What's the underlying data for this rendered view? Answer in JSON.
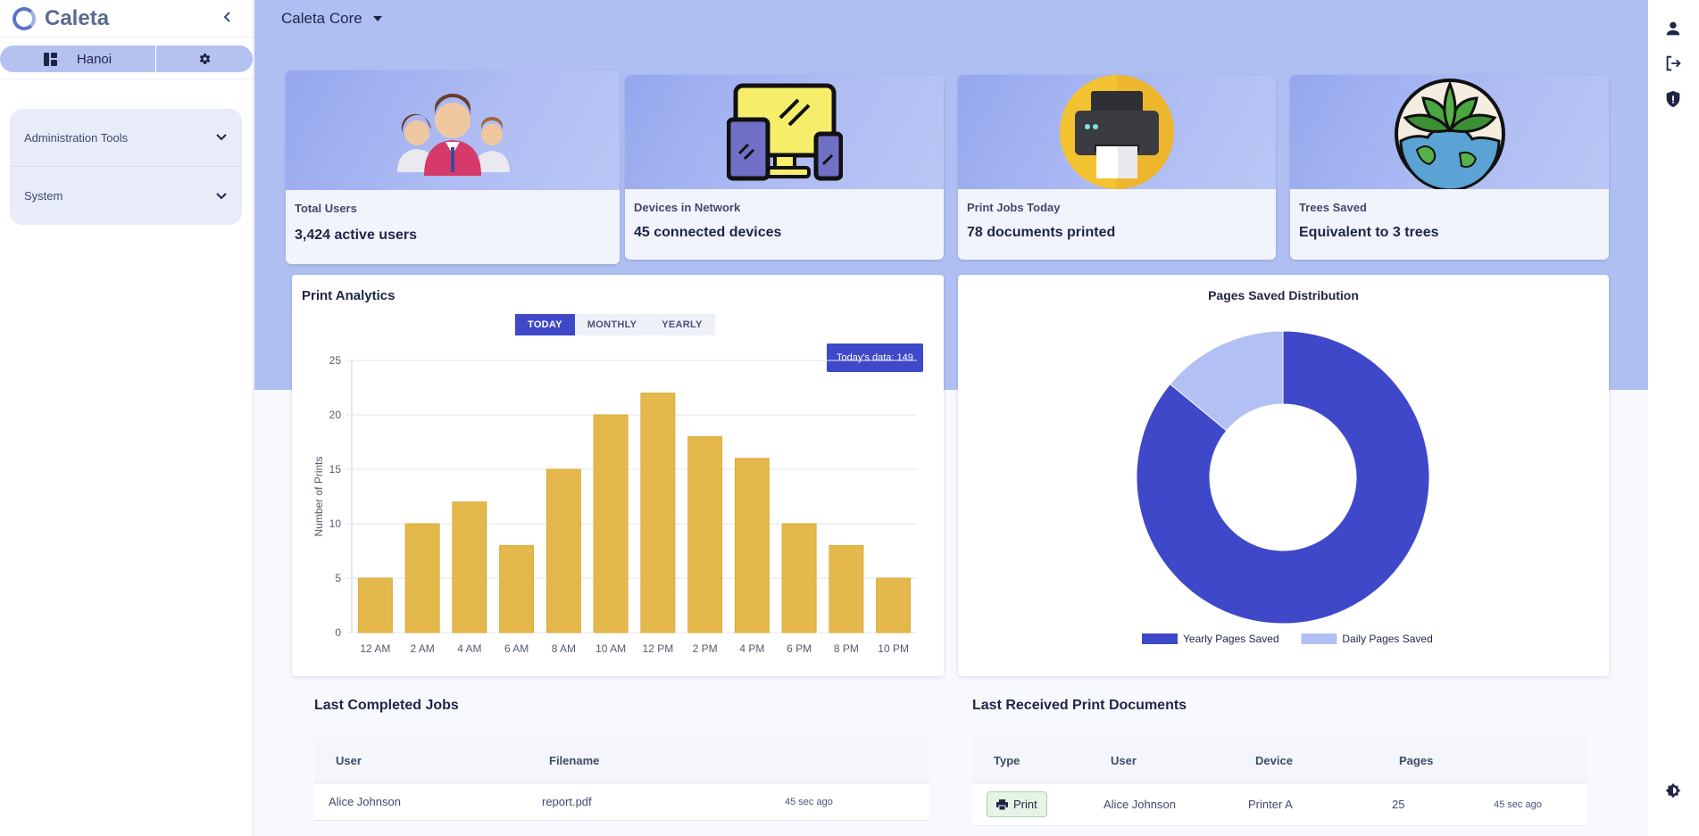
{
  "app": {
    "name": "Caleta"
  },
  "sidebar": {
    "site_name": "Hanoi",
    "menu": [
      {
        "label": "Administration Tools"
      },
      {
        "label": "System"
      }
    ]
  },
  "header": {
    "org_select": "Caleta Core"
  },
  "stats": [
    {
      "label": "Total Users",
      "value": "3,424 active users",
      "icon": "users-illustration"
    },
    {
      "label": "Devices in Network",
      "value": "45 connected devices",
      "icon": "devices-illustration"
    },
    {
      "label": "Print Jobs Today",
      "value": "78 documents printed",
      "icon": "printer-illustration"
    },
    {
      "label": "Trees Saved",
      "value": "Equivalent to 3 trees",
      "icon": "earth-leaves-illustration"
    }
  ],
  "print_analytics": {
    "title": "Print Analytics",
    "tabs": [
      "TODAY",
      "MONTHLY",
      "YEARLY"
    ],
    "active_tab": "TODAY",
    "today_pill": "Today's data: 149"
  },
  "pages_saved": {
    "title": "Pages Saved Distribution"
  },
  "chart_data": [
    {
      "type": "bar",
      "title": "",
      "xlabel": "",
      "ylabel": "Number of Prints",
      "categories": [
        "12 AM",
        "2 AM",
        "4 AM",
        "6 AM",
        "8 AM",
        "10 AM",
        "12 PM",
        "2 PM",
        "4 PM",
        "6 PM",
        "8 PM",
        "10 PM"
      ],
      "values": [
        5,
        10,
        12,
        8,
        15,
        20,
        22,
        18,
        16,
        10,
        8,
        5
      ],
      "ylim": [
        0,
        25
      ],
      "yticks": [
        0,
        5,
        10,
        15,
        20,
        25
      ],
      "color": "#e4b84a",
      "grid": true
    },
    {
      "type": "pie",
      "donut": true,
      "title": "Pages Saved Distribution",
      "categories": [
        "Yearly Pages Saved",
        "Daily Pages Saved"
      ],
      "values": [
        86,
        14
      ],
      "colors": [
        "#3f48c9",
        "#b3c0f3"
      ],
      "legend": "bottom"
    }
  ],
  "completed_jobs": {
    "title": "Last Completed Jobs",
    "columns": [
      "User",
      "Filename",
      ""
    ],
    "rows": [
      {
        "user": "Alice Johnson",
        "filename": "report.pdf",
        "time": "45 sec ago"
      }
    ]
  },
  "received_docs": {
    "title": "Last Received Print Documents",
    "columns": [
      "Type",
      "User",
      "Device",
      "Pages",
      ""
    ],
    "rows": [
      {
        "type": "Print",
        "user": "Alice Johnson",
        "device": "Printer A",
        "pages": "25",
        "time": "45 sec ago"
      }
    ]
  },
  "colors": {
    "accent": "#3f48c9",
    "band": "#b0bff2",
    "bar": "#e4b84a",
    "pie_secondary": "#b3c0f3"
  }
}
